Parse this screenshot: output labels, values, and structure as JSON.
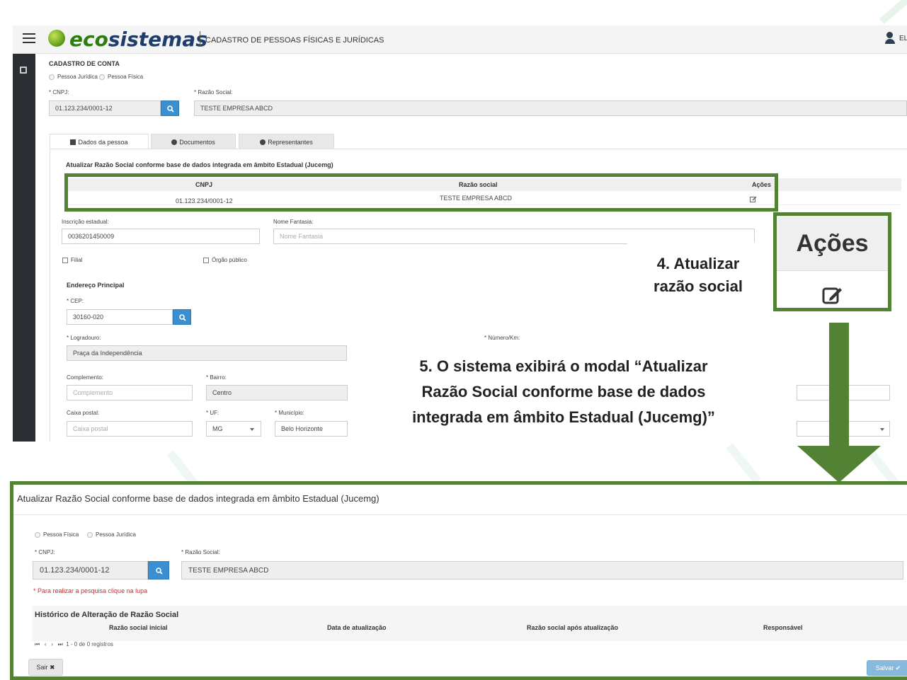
{
  "app": {
    "brand_part1": "eco",
    "brand_part2": "sistemas",
    "subtitle": "CADASTRO DE PESSOAS FÍSICAS E JURÍDICAS",
    "user_name_visible": "EL"
  },
  "form": {
    "section_title": "CADASTRO DE CONTA",
    "radio_pj": "Pessoa Jurídica",
    "radio_pf": "Pessoa Física",
    "cnpj_label": "* CNPJ:",
    "cnpj_value": "01.123.234/0001-12",
    "razao_label": "* Razão Social:",
    "razao_value": "TESTE EMPRESA ABCD"
  },
  "tabs": [
    {
      "label": "Dados da pessoa",
      "icon": "file-icon"
    },
    {
      "label": "Documentos",
      "icon": "cloud-icon"
    },
    {
      "label": "Representantes",
      "icon": "users-icon"
    }
  ],
  "panel": {
    "section_title": "Atualizar Razão Social conforme base de dados integrada em âmbito Estadual (Jucemg)",
    "table_headers": [
      "CNPJ",
      "Razão social",
      "Ações"
    ],
    "table_row": {
      "cnpj": "01.123.234/0001-12",
      "razao": "TESTE EMPRESA ABCD"
    },
    "ie_label": "Inscrição estadual:",
    "ie_value": "0036201450009",
    "fantasia_label": "Nome Fantasia:",
    "fantasia_placeholder": "Nome Fantasia",
    "filial_label": "Filial",
    "orgao_label": "Órgão público",
    "endereco_title": "Endereço Principal",
    "cep_label": "* CEP:",
    "cep_value": "30160-020",
    "logradouro_label": "* Logradouro:",
    "logradouro_value": "Praça da Independência",
    "numero_label": "* Número/Km:",
    "complemento_label": "Complemento:",
    "complemento_placeholder": "Complemento",
    "bairro_label": "* Bairro:",
    "bairro_value": "Centro",
    "caixa_label": "Caixa postal:",
    "caixa_placeholder": "Caixa postal",
    "uf_label": "* UF:",
    "uf_value": "MG",
    "municipio_label": "* Município:",
    "municipio_value": "Belo Horizonte"
  },
  "callouts": {
    "step4_line1": "4. Atualizar",
    "step4_line2": "razão social",
    "zoom_header": "Ações",
    "step5_line1": "5. O sistema exibirá o modal “Atualizar",
    "step5_line2": "Razão Social conforme base de dados",
    "step5_line3": "integrada em âmbito Estadual (Jucemg)”"
  },
  "modal": {
    "title": "Atualizar Razão Social conforme base de dados integrada em âmbito Estadual (Jucemg)",
    "radio_pf": "Pessoa Física",
    "radio_pj": "Pessoa Jurídica",
    "cnpj_label": "* CNPJ:",
    "cnpj_value": "01.123.234/0001-12",
    "razao_label": "* Razão Social:",
    "razao_value": "TESTE EMPRESA ABCD",
    "required_note": "* Para realizar a pesquisa clique na lupa",
    "history_title": "Histórico de Alteração de Razão Social",
    "history_headers": [
      "Razão social inicial",
      "Data de atualização",
      "Razão social após atualização",
      "Responsável"
    ],
    "pager_text": "1 - 0 de 0 registros",
    "exit_label": "Sair",
    "save_label": "Salvar"
  },
  "colors": {
    "highlight": "#548235",
    "primary_button": "#3a8fd1",
    "required_text": "#d9262c"
  }
}
